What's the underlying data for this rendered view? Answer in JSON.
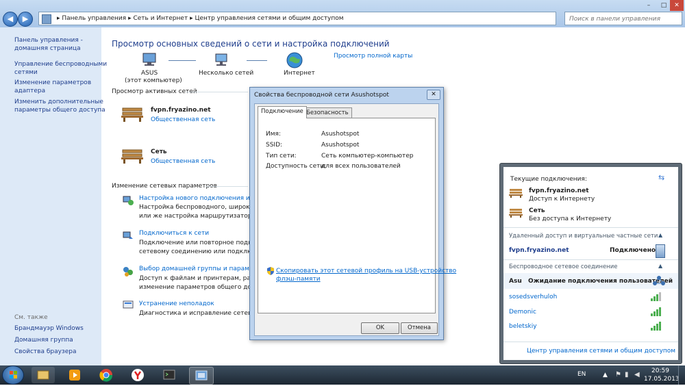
{
  "window": {
    "breadcrumbs": [
      "Панель управления",
      "Сеть и Интернет",
      "Центр управления сетями и общим доступом"
    ],
    "search_placeholder": "Поиск в панели управления",
    "buttons": [
      "–",
      "□",
      "✕"
    ]
  },
  "sidebar": {
    "links": [
      "Панель управления -",
      "домашняя страница",
      "Управление беспроводными",
      "сетями",
      "Изменение параметров",
      "адаптера",
      "Изменить дополнительные",
      "параметры общего доступа"
    ],
    "see_also": "См. также",
    "see_also_links": [
      "Брандмауэр Windows",
      "Домашняя группа",
      "Свойства браузера"
    ]
  },
  "main": {
    "title": "Просмотр основных сведений о сети и настройка подключений",
    "map": {
      "computer_label": "ASUS",
      "computer_sub": "(этот компьютер)",
      "multi_label": "Несколько сетей",
      "internet_label": "Интернет",
      "full_map_link": "Просмотр полной карты"
    },
    "active_header": "Просмотр активных сетей",
    "networks": [
      {
        "name": "fvpn.fryazino.net",
        "type": "Общественная сеть"
      },
      {
        "name": "Сеть",
        "type": "Общественная сеть"
      }
    ],
    "change_header": "Изменение сетевых параметров",
    "tasks": [
      {
        "title": "Настройка нового подключения или се",
        "lines": [
          "Настройка беспроводного, широкопол",
          "или же настройка маршрутизатора или"
        ]
      },
      {
        "title": "Подключиться к сети",
        "lines": [
          "Подключение или повторное подключе",
          "сетевому соединению или подключени"
        ]
      },
      {
        "title": "Выбор домашней группы и параметров",
        "lines": [
          "Доступ к файлам и принтерам, располо",
          "изменение параметров общего доступа"
        ]
      },
      {
        "title": "Устранение неполадок",
        "lines": [
          "Диагностика и исправление сетевых пр"
        ]
      }
    ]
  },
  "dialog": {
    "title": "Свойства беспроводной сети Asushotspot",
    "tabs": [
      "Подключение",
      "Безопасность"
    ],
    "fields": [
      {
        "label": "Имя:",
        "value": "Asushotspot"
      },
      {
        "label": "SSID:",
        "value": "Asushotspot"
      },
      {
        "label": "Тип сети:",
        "value": "Сеть компьютер-компьютер"
      },
      {
        "label": "Доступность сети:",
        "value": "для всех пользователей"
      }
    ],
    "copy_link_1": "Скопировать этот сетевой профиль на USB-устройство",
    "copy_link_2": "флэш-памяти",
    "ok": "OK",
    "cancel": "Отмена"
  },
  "flyout": {
    "current_header": "Текущие подключения:",
    "connections": [
      {
        "name": "fvpn.fryazino.net",
        "status": "Доступ к Интернету"
      },
      {
        "name": "Сеть",
        "status": "Без доступа к Интернету"
      }
    ],
    "vpn_header": "Удаленный доступ и виртуальные частные сети",
    "vpn_name": "fvpn.fryazino.net",
    "vpn_status": "Подключено",
    "wireless_header": "Беспроводное сетевое соединение",
    "wireless_current_name": "Asu",
    "wireless_current_status": "Ожидание подключения пользователей",
    "wireless_networks": [
      "sosedsverhuloh",
      "Demonic",
      "beletskiy"
    ],
    "footer_link": "Центр управления сетями и общим доступом"
  },
  "taskbar": {
    "lang": "EN",
    "time": "20:59",
    "date": "17.05.2013"
  },
  "colors": {
    "link": "#0066cc",
    "heading": "#1e3d8c",
    "sidebar_bg": "#dde9f7"
  }
}
